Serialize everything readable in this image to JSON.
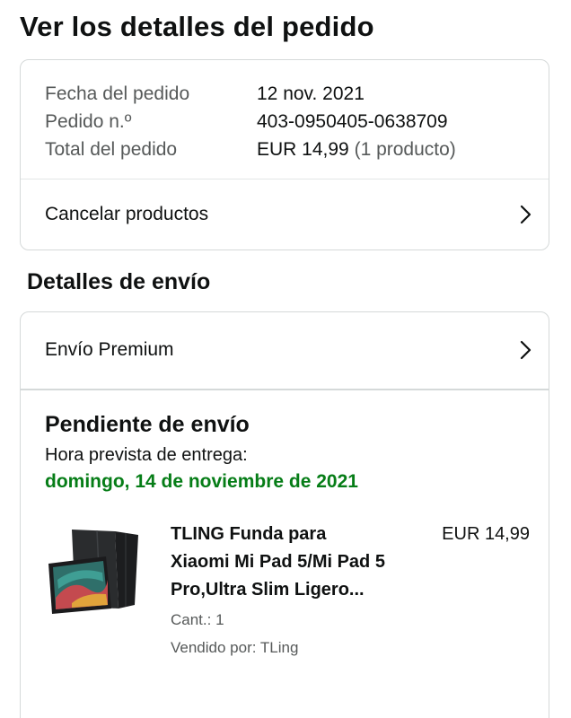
{
  "page": {
    "title": "Ver los detalles del pedido"
  },
  "order_summary": {
    "rows": [
      {
        "label": "Fecha del pedido",
        "value": "12 nov. 2021"
      },
      {
        "label": "Pedido n.º",
        "value": "403-0950405-0638709"
      },
      {
        "label": "Total del pedido",
        "value": "EUR 14,99",
        "extra": "(1 producto)"
      }
    ],
    "cancel_label": "Cancelar productos"
  },
  "shipping": {
    "heading": "Detalles de envío",
    "method_label": "Envío Premium",
    "status": "Pendiente de envío",
    "delivery_label": "Hora prevista de entrega:",
    "delivery_date": "domingo, 14 de noviembre de 2021",
    "delivery_color": "#067d17"
  },
  "product": {
    "title": "TLING Funda para Xiaomi Mi Pad 5/Mi Pad 5 Pro,Ultra Slim Ligero...",
    "price": "EUR 14,99",
    "quantity": "Cant.: 1",
    "seller": "Vendido por: TLing",
    "image_icon": "tablet-case-image"
  },
  "icons": {
    "chevron": "chevron-right-icon"
  }
}
